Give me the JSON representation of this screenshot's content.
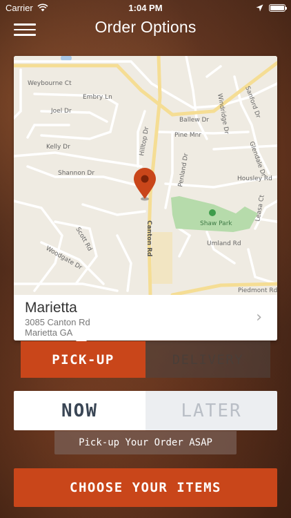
{
  "status_bar": {
    "carrier": "Carrier",
    "time": "1:04 PM",
    "battery_level": 1.0,
    "icons": [
      "wifi-icon",
      "location-arrow-icon",
      "battery-icon"
    ]
  },
  "nav": {
    "title": "Order Options",
    "menu_icon": "hamburger-icon"
  },
  "map": {
    "street_labels": [
      "Weybourne Ct",
      "Embry Ln",
      "Joel Dr",
      "Kelly Dr",
      "Shannon Dr",
      "Hilltop Dr",
      "Ballew Dr",
      "Pine Mnr",
      "Windridge Dr",
      "Sanford Dr",
      "Glendale Dr",
      "Housley Rd",
      "Penland Dr",
      "Canton Rd",
      "Shaw Park",
      "Umland Rd",
      "Scott Rd",
      "Woodgate Dr",
      "Leasa Ct",
      "Piedmont Rd"
    ],
    "pin_icon": "map-pin-icon",
    "park_icon": "park-icon"
  },
  "location": {
    "name": "Marietta",
    "address_line1": "3085 Canton Rd",
    "address_line2": "Marietta GA",
    "chevron": "›"
  },
  "order_type": {
    "pickup_label": "PICK-UP",
    "delivery_label": "DELIVERY",
    "selected": "pickup"
  },
  "timing": {
    "now_label": "NOW",
    "later_label": "LATER",
    "selected": "now",
    "message": "Pick-up Your Order ASAP"
  },
  "cta": {
    "label": "CHOOSE YOUR ITEMS"
  },
  "colors": {
    "accent": "#c9461a",
    "map_bg": "#efebe2",
    "park": "#a8d5a0",
    "pin": "#c9461a",
    "road_major": "#f8e5a6"
  }
}
